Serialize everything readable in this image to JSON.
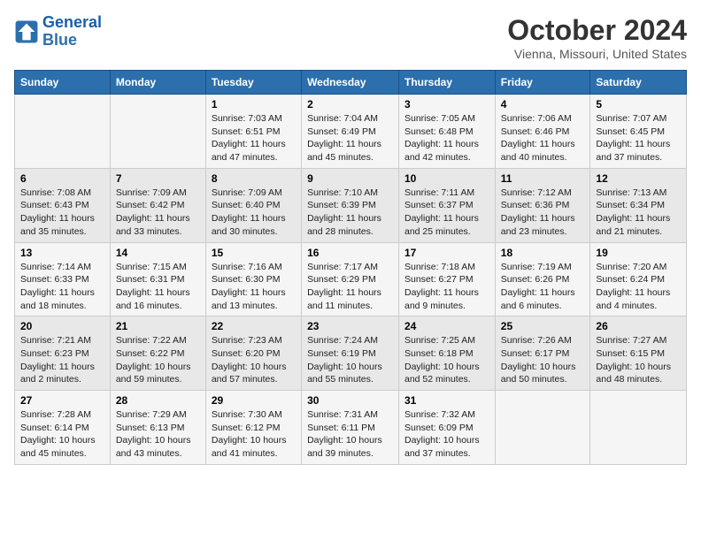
{
  "logo": {
    "line1": "General",
    "line2": "Blue"
  },
  "title": "October 2024",
  "location": "Vienna, Missouri, United States",
  "days_of_week": [
    "Sunday",
    "Monday",
    "Tuesday",
    "Wednesday",
    "Thursday",
    "Friday",
    "Saturday"
  ],
  "weeks": [
    [
      {
        "num": "",
        "info": ""
      },
      {
        "num": "",
        "info": ""
      },
      {
        "num": "1",
        "info": "Sunrise: 7:03 AM\nSunset: 6:51 PM\nDaylight: 11 hours and 47 minutes."
      },
      {
        "num": "2",
        "info": "Sunrise: 7:04 AM\nSunset: 6:49 PM\nDaylight: 11 hours and 45 minutes."
      },
      {
        "num": "3",
        "info": "Sunrise: 7:05 AM\nSunset: 6:48 PM\nDaylight: 11 hours and 42 minutes."
      },
      {
        "num": "4",
        "info": "Sunrise: 7:06 AM\nSunset: 6:46 PM\nDaylight: 11 hours and 40 minutes."
      },
      {
        "num": "5",
        "info": "Sunrise: 7:07 AM\nSunset: 6:45 PM\nDaylight: 11 hours and 37 minutes."
      }
    ],
    [
      {
        "num": "6",
        "info": "Sunrise: 7:08 AM\nSunset: 6:43 PM\nDaylight: 11 hours and 35 minutes."
      },
      {
        "num": "7",
        "info": "Sunrise: 7:09 AM\nSunset: 6:42 PM\nDaylight: 11 hours and 33 minutes."
      },
      {
        "num": "8",
        "info": "Sunrise: 7:09 AM\nSunset: 6:40 PM\nDaylight: 11 hours and 30 minutes."
      },
      {
        "num": "9",
        "info": "Sunrise: 7:10 AM\nSunset: 6:39 PM\nDaylight: 11 hours and 28 minutes."
      },
      {
        "num": "10",
        "info": "Sunrise: 7:11 AM\nSunset: 6:37 PM\nDaylight: 11 hours and 25 minutes."
      },
      {
        "num": "11",
        "info": "Sunrise: 7:12 AM\nSunset: 6:36 PM\nDaylight: 11 hours and 23 minutes."
      },
      {
        "num": "12",
        "info": "Sunrise: 7:13 AM\nSunset: 6:34 PM\nDaylight: 11 hours and 21 minutes."
      }
    ],
    [
      {
        "num": "13",
        "info": "Sunrise: 7:14 AM\nSunset: 6:33 PM\nDaylight: 11 hours and 18 minutes."
      },
      {
        "num": "14",
        "info": "Sunrise: 7:15 AM\nSunset: 6:31 PM\nDaylight: 11 hours and 16 minutes."
      },
      {
        "num": "15",
        "info": "Sunrise: 7:16 AM\nSunset: 6:30 PM\nDaylight: 11 hours and 13 minutes."
      },
      {
        "num": "16",
        "info": "Sunrise: 7:17 AM\nSunset: 6:29 PM\nDaylight: 11 hours and 11 minutes."
      },
      {
        "num": "17",
        "info": "Sunrise: 7:18 AM\nSunset: 6:27 PM\nDaylight: 11 hours and 9 minutes."
      },
      {
        "num": "18",
        "info": "Sunrise: 7:19 AM\nSunset: 6:26 PM\nDaylight: 11 hours and 6 minutes."
      },
      {
        "num": "19",
        "info": "Sunrise: 7:20 AM\nSunset: 6:24 PM\nDaylight: 11 hours and 4 minutes."
      }
    ],
    [
      {
        "num": "20",
        "info": "Sunrise: 7:21 AM\nSunset: 6:23 PM\nDaylight: 11 hours and 2 minutes."
      },
      {
        "num": "21",
        "info": "Sunrise: 7:22 AM\nSunset: 6:22 PM\nDaylight: 10 hours and 59 minutes."
      },
      {
        "num": "22",
        "info": "Sunrise: 7:23 AM\nSunset: 6:20 PM\nDaylight: 10 hours and 57 minutes."
      },
      {
        "num": "23",
        "info": "Sunrise: 7:24 AM\nSunset: 6:19 PM\nDaylight: 10 hours and 55 minutes."
      },
      {
        "num": "24",
        "info": "Sunrise: 7:25 AM\nSunset: 6:18 PM\nDaylight: 10 hours and 52 minutes."
      },
      {
        "num": "25",
        "info": "Sunrise: 7:26 AM\nSunset: 6:17 PM\nDaylight: 10 hours and 50 minutes."
      },
      {
        "num": "26",
        "info": "Sunrise: 7:27 AM\nSunset: 6:15 PM\nDaylight: 10 hours and 48 minutes."
      }
    ],
    [
      {
        "num": "27",
        "info": "Sunrise: 7:28 AM\nSunset: 6:14 PM\nDaylight: 10 hours and 45 minutes."
      },
      {
        "num": "28",
        "info": "Sunrise: 7:29 AM\nSunset: 6:13 PM\nDaylight: 10 hours and 43 minutes."
      },
      {
        "num": "29",
        "info": "Sunrise: 7:30 AM\nSunset: 6:12 PM\nDaylight: 10 hours and 41 minutes."
      },
      {
        "num": "30",
        "info": "Sunrise: 7:31 AM\nSunset: 6:11 PM\nDaylight: 10 hours and 39 minutes."
      },
      {
        "num": "31",
        "info": "Sunrise: 7:32 AM\nSunset: 6:09 PM\nDaylight: 10 hours and 37 minutes."
      },
      {
        "num": "",
        "info": ""
      },
      {
        "num": "",
        "info": ""
      }
    ]
  ]
}
